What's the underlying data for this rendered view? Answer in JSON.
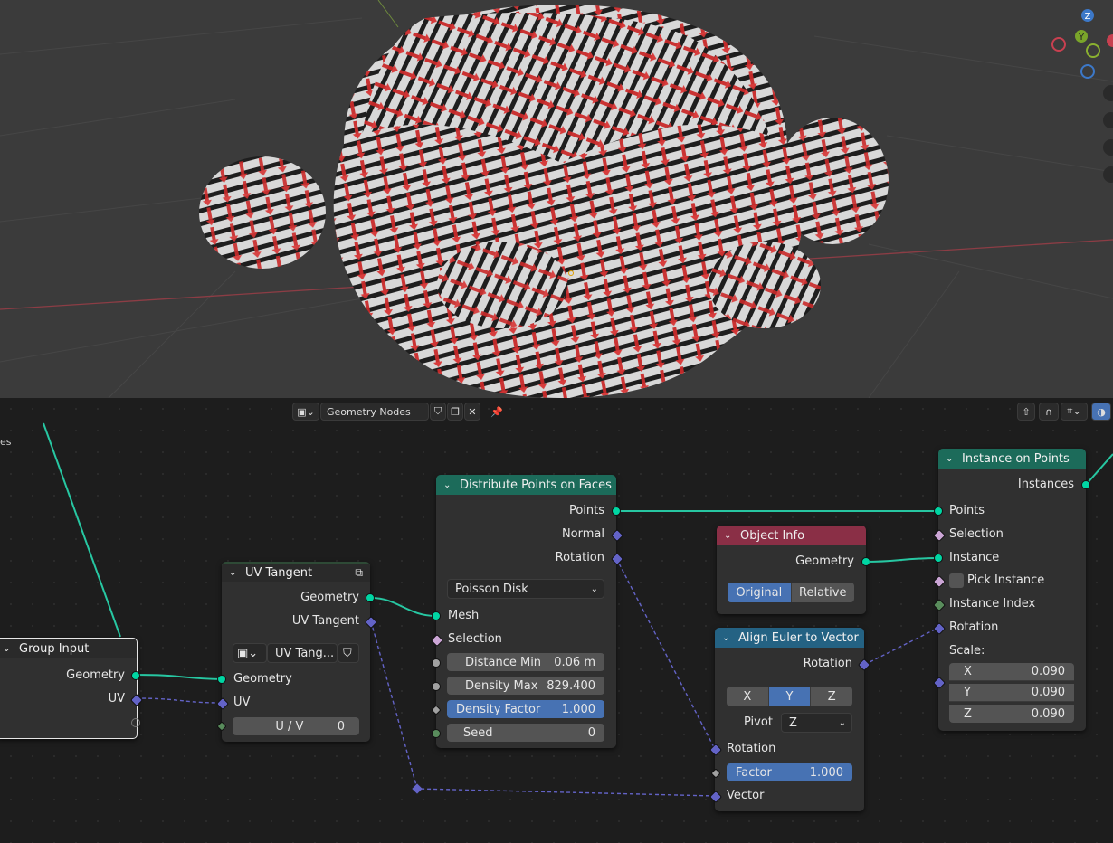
{
  "header": {
    "tree_name": "Geometry Nodes",
    "partial_label": "es"
  },
  "gizmo": {
    "z_label": "Z",
    "y_label": "Y"
  },
  "nodes": {
    "group_input": {
      "title": "Group Input",
      "outputs": [
        "Geometry",
        "UV"
      ]
    },
    "uv_tangent": {
      "title": "UV Tangent",
      "outputs": [
        "Geometry",
        "UV Tangent"
      ],
      "dropdown": "UV Tang...",
      "inputs": [
        "Geometry",
        "UV"
      ],
      "uv_field": {
        "label": "U / V",
        "value": "0"
      }
    },
    "distribute": {
      "title": "Distribute Points on Faces",
      "outputs": [
        "Points",
        "Normal",
        "Rotation"
      ],
      "mode": "Poisson Disk",
      "inputs": [
        "Mesh",
        "Selection"
      ],
      "fields": [
        {
          "label": "Distance Min",
          "value": "0.06 m"
        },
        {
          "label": "Density Max",
          "value": "829.400"
        },
        {
          "label": "Density Factor",
          "value": "1.000"
        },
        {
          "label": "Seed",
          "value": "0"
        }
      ]
    },
    "object_info": {
      "title": "Object Info",
      "outputs": [
        "Geometry"
      ],
      "toggle": [
        "Original",
        "Relative"
      ],
      "selected": "Original"
    },
    "align_euler": {
      "title": "Align Euler to Vector",
      "outputs": [
        "Rotation"
      ],
      "axes": [
        "X",
        "Y",
        "Z"
      ],
      "selected_axis": "Y",
      "pivot_label": "Pivot",
      "pivot_value": "Z",
      "inputs": [
        "Rotation",
        "Vector"
      ],
      "factor": {
        "label": "Factor",
        "value": "1.000"
      }
    },
    "instance_on_points": {
      "title": "Instance on Points",
      "outputs": [
        "Instances"
      ],
      "inputs": [
        "Points",
        "Selection",
        "Instance",
        "Pick Instance",
        "Instance Index",
        "Rotation"
      ],
      "scale_label": "Scale:",
      "scale": [
        {
          "label": "X",
          "value": "0.090"
        },
        {
          "label": "Y",
          "value": "0.090"
        },
        {
          "label": "Z",
          "value": "0.090"
        }
      ]
    }
  },
  "colors": {
    "geometry_socket": "#00d6a3",
    "vector_socket": "#6363c7",
    "node_header_green": "#1c6b5a",
    "node_header_red": "#8a2f46",
    "node_header_blue": "#246283",
    "node_header_dark": "#2a2a2a",
    "selection_blue": "#4772b3"
  }
}
